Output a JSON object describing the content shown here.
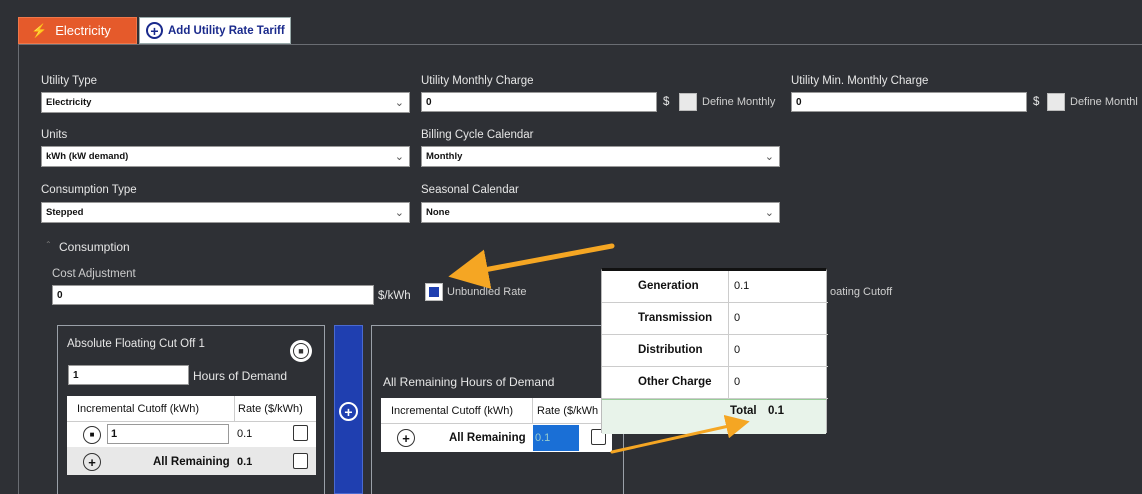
{
  "tabs": {
    "electricity": "Electricity",
    "add_tariff": "Add Utility Rate Tariff"
  },
  "form": {
    "utility_type": {
      "label": "Utility Type",
      "value": "Electricity"
    },
    "utility_monthly_charge": {
      "label": "Utility Monthly Charge",
      "value": "0",
      "unit": "$",
      "define_label": "Define Monthly"
    },
    "utility_min_monthly_charge": {
      "label": "Utility Min. Monthly Charge",
      "value": "0",
      "unit": "$",
      "define_label": "Define Monthl"
    },
    "units": {
      "label": "Units",
      "value": "kWh (kW demand)"
    },
    "billing_cycle": {
      "label": "Billing Cycle Calendar",
      "value": "Monthly"
    },
    "consumption_type": {
      "label": "Consumption Type",
      "value": "Stepped"
    },
    "seasonal_calendar": {
      "label": "Seasonal Calendar",
      "value": "None"
    }
  },
  "consumption": {
    "header": "Consumption",
    "cost_adjustment_label": "Cost Adjustment",
    "cost_adjustment_value": "0",
    "cost_unit": "$/kWh",
    "unbundled_label": "Unbundled Rate",
    "floating_cutoff_label": "oating Cutoff"
  },
  "cutoff1": {
    "title": "Absolute Floating Cut Off 1",
    "hours_value": "1",
    "hours_label": "Hours of Demand",
    "col_cutoff": "Incremental Cutoff (kWh)",
    "col_rate": "Rate ($/kWh)",
    "row1_cutoff": "1",
    "row1_rate": "0.1",
    "row2_label": "All Remaining",
    "row2_rate": "0.1"
  },
  "remaining": {
    "title": "All Remaining Hours of Demand",
    "col_cutoff": "Incremental Cutoff (kWh)",
    "col_rate": "Rate ($/kWh",
    "row_label": "All Remaining",
    "row_rate": "0.1"
  },
  "popup": {
    "rows": [
      {
        "name": "Generation",
        "value": "0.1"
      },
      {
        "name": "Transmission",
        "value": "0"
      },
      {
        "name": "Distribution",
        "value": "0"
      },
      {
        "name": "Other Charge",
        "value": "0"
      }
    ],
    "total_label": "Total",
    "total_value": "0.1"
  },
  "colors": {
    "accent_orange": "#e55a2b",
    "arrow": "#f5a623",
    "blue": "#1f3fb0"
  }
}
